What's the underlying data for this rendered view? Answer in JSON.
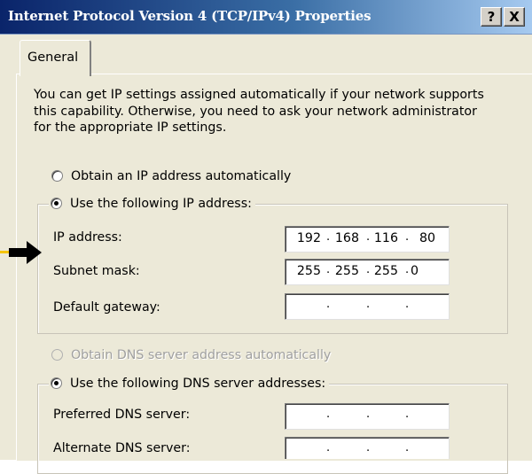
{
  "window": {
    "title": "Internet Protocol Version 4 (TCP/IPv4) Properties",
    "help_button": "?",
    "close_button": "X"
  },
  "tabs": [
    {
      "label": "General",
      "active": true
    }
  ],
  "intro_lines": [
    "You can get IP settings assigned automatically if your network supports",
    "this capability. Otherwise, you need to ask your network administrator",
    "for the appropriate IP settings."
  ],
  "ip_section": {
    "auto_label": "Obtain an IP address automatically",
    "manual_label": "Use the following IP address:",
    "selected": "manual",
    "fields": [
      {
        "label": "IP address:",
        "octets": [
          "192",
          "168",
          "116",
          "80"
        ]
      },
      {
        "label": "Subnet mask:",
        "octets": [
          "255",
          "255",
          "255",
          "0"
        ]
      },
      {
        "label": "Default gateway:",
        "octets": [
          "",
          "",
          "",
          ""
        ]
      }
    ]
  },
  "dns_section": {
    "auto_label": "Obtain DNS server address automatically",
    "manual_label": "Use the following DNS server addresses:",
    "selected": "manual",
    "fields": [
      {
        "label": "Preferred DNS server:",
        "octets": [
          "",
          "",
          "",
          ""
        ]
      },
      {
        "label": "Alternate DNS server:",
        "octets": [
          "",
          "",
          "",
          ""
        ]
      }
    ]
  },
  "colors": {
    "title_bar_start": "#0a246a",
    "title_bar_end": "#a6caf0",
    "dialog_bg": "#ece9d8",
    "annotation_arrow": "#000000",
    "annotation_line": "#f5c400"
  },
  "annotation": {
    "icon": "pointer-arrow-icon",
    "points_to": "IP address"
  }
}
